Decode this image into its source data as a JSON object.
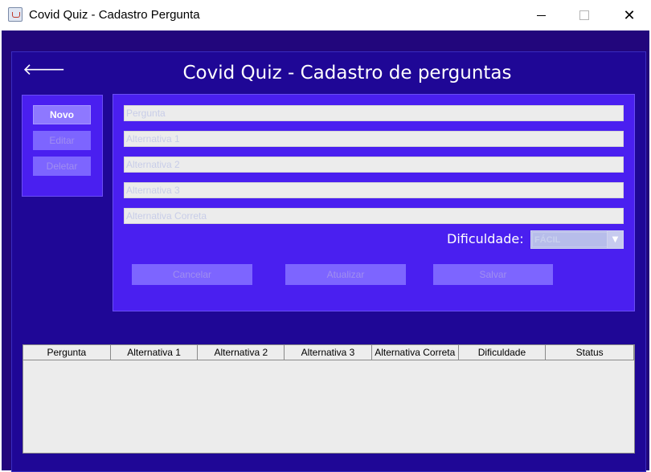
{
  "window": {
    "title": "Covid Quiz - Cadastro Pergunta",
    "minimize_glyph": "",
    "maximize_glyph": "",
    "close_glyph": "✕"
  },
  "header": {
    "back_glyph": "🡐",
    "title": "Covid Quiz - Cadastro de perguntas"
  },
  "sidebar": {
    "buttons": [
      {
        "label": "Novo",
        "enabled": true
      },
      {
        "label": "Editar",
        "enabled": false
      },
      {
        "label": "Deletar",
        "enabled": false
      }
    ]
  },
  "form": {
    "fields": [
      {
        "placeholder": "Pergunta",
        "value": ""
      },
      {
        "placeholder": "Alternativa 1",
        "value": ""
      },
      {
        "placeholder": "Alternativa 2",
        "value": ""
      },
      {
        "placeholder": "Alternativa 3",
        "value": ""
      },
      {
        "placeholder": "Alternativa Correta",
        "value": ""
      }
    ],
    "difficulty_label": "Dificuldade:",
    "difficulty_value": "FÁCIL",
    "dropdown_arrow_glyph": "▼"
  },
  "actions": {
    "buttons": [
      {
        "label": "Cancelar",
        "enabled": false
      },
      {
        "label": "Atualizar",
        "enabled": false
      },
      {
        "label": "Salvar",
        "enabled": false
      }
    ]
  },
  "table": {
    "columns": [
      "Pergunta",
      "Alternativa 1",
      "Alternativa 2",
      "Alternativa 3",
      "Alternativa Correta",
      "Dificuldade",
      "Status"
    ],
    "rows": []
  },
  "colors": {
    "frame_bg": "#22067c",
    "panel_bg": "#4a1ff0",
    "button_active": "#8e78ff",
    "button_disabled": "#7d65ff"
  }
}
